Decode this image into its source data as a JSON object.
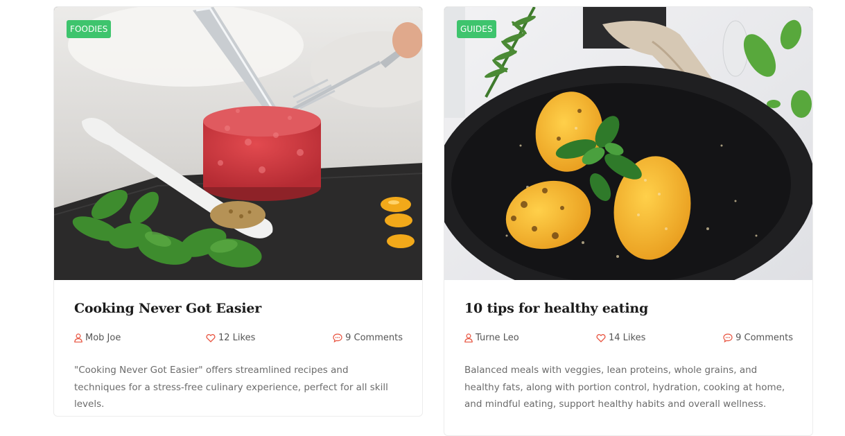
{
  "cards": [
    {
      "category": "FOODIES",
      "title": "Cooking Never Got Easier",
      "author": "Mob Joe",
      "likes": "12 Likes",
      "comments": "9 Comments",
      "excerpt": "\"Cooking Never Got Easier\" offers streamlined recipes and techniques for a stress-free culinary experience, perfect for all skill levels.",
      "image_icon": "steak-tartare-photo"
    },
    {
      "category": "GUIDES",
      "title": "10 tips for healthy eating",
      "author": "Turne Leo",
      "likes": "14 Likes",
      "comments": "9 Comments",
      "excerpt": "Balanced meals with veggies, lean proteins, whole grains, and healthy fats, along with portion control, hydration, cooking at home, and mindful eating, support healthy habits and overall wellness.",
      "image_icon": "grilled-corn-photo"
    }
  ],
  "colors": {
    "accent": "#3ec46d",
    "icon_red": "#e8533f",
    "title": "#1b1b1b",
    "text": "#6b6b6b"
  }
}
